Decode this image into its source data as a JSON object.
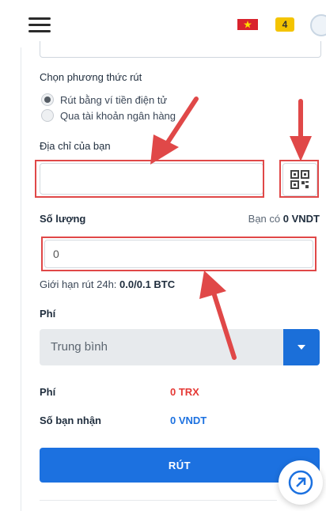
{
  "header": {
    "notification_count": "4",
    "icons": [
      "menu-icon",
      "vietnam-flag-icon",
      "notification-icon",
      "avatar-icon"
    ]
  },
  "form": {
    "method_label": "Chọn phương thức rút",
    "options": [
      {
        "label": "Rút bằng ví tiền điện tử",
        "selected": true
      },
      {
        "label": "Qua tài khoản ngân hàng",
        "selected": false
      }
    ],
    "address_label": "Địa chỉ của bạn",
    "address_value": "",
    "amount_label": "Số lượng",
    "balance_prefix": "Bạn có",
    "balance_value": "0 VNDT",
    "amount_value": "0",
    "limit_prefix": "Giới hạn rút 24h:",
    "limit_value": "0.0/0.1 BTC",
    "fee_label": "Phí",
    "fee_select": "Trung bình",
    "fee_summary_label": "Phí",
    "fee_summary_value": "0 TRX",
    "receive_label": "Số bạn nhận",
    "receive_value": "0 VNDT",
    "submit_label": "RÚT"
  },
  "colors": {
    "accent": "#1c71e0",
    "highlight": "#e04848",
    "fee_red": "#e53935",
    "receive_blue": "#1c71e0"
  }
}
